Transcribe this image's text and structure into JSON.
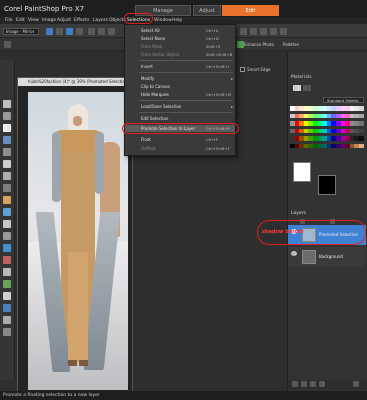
{
  "app": {
    "title": "Corel PaintShop Pro X7",
    "workspace_tabs": [
      "Manage",
      "Adjust",
      "Edit"
    ],
    "active_workspace": "Edit"
  },
  "menubar": {
    "items": [
      "File",
      "Edit",
      "View",
      "Image",
      "Adjust",
      "Effects",
      "Layers",
      "Objects",
      "Selections",
      "Window",
      "Help"
    ],
    "open_menu": "Selections"
  },
  "toolbar": {
    "preset": "Image - Mirror",
    "enhance_photo": "Enhance Photo",
    "palettes": "Palettes",
    "smart_edge": "Smart Edge"
  },
  "document": {
    "title": "hijab%20fashion (4)* @ 39% (Promoted Selection)"
  },
  "selections_menu": {
    "items": [
      {
        "label": "Select All",
        "shortcut": "Ctrl+A",
        "disabled": false
      },
      {
        "label": "Select None",
        "shortcut": "Ctrl+D",
        "disabled": false
      },
      {
        "label": "From Mask",
        "shortcut": "Shift+S",
        "disabled": true
      },
      {
        "label": "From Vector Object",
        "shortcut": "Shift+Shift+B",
        "disabled": true
      },
      {
        "label": "Invert",
        "shortcut": "Ctrl+Shift+I",
        "disabled": false
      },
      {
        "label": "Modify",
        "shortcut": "",
        "disabled": false,
        "submenu": true
      },
      {
        "label": "Clip to Canvas",
        "shortcut": "",
        "disabled": false
      },
      {
        "label": "Hide Marquee",
        "shortcut": "Ctrl+Shift+M",
        "disabled": false
      },
      {
        "label": "Load/Save Selection",
        "shortcut": "",
        "disabled": false,
        "submenu": true
      },
      {
        "label": "Edit Selection",
        "shortcut": "",
        "disabled": false
      },
      {
        "label": "Promote Selection to Layer",
        "shortcut": "Ctrl+Shift+P",
        "disabled": false,
        "highlighted": true
      },
      {
        "label": "Float",
        "shortcut": "Ctrl+F",
        "disabled": false
      },
      {
        "label": "Defloat",
        "shortcut": "Ctrl+Shift+F",
        "disabled": true
      }
    ]
  },
  "materials": {
    "title": "Materials",
    "swatch_set": "Standard Palette",
    "palette_colors": [
      "#ffffff",
      "#ffcccc",
      "#ffe6cc",
      "#ffffcc",
      "#e6ffcc",
      "#ccffcc",
      "#ccffe6",
      "#ccffff",
      "#cce6ff",
      "#ccccff",
      "#e6ccff",
      "#ffccff",
      "#ffcce6",
      "#f2f2f2",
      "#e6e6e6",
      "#d9d9d9",
      "#cccccc",
      "#ff6666",
      "#ffb366",
      "#ffff66",
      "#b3ff66",
      "#66ff66",
      "#66ffb3",
      "#66ffff",
      "#66b3ff",
      "#6666ff",
      "#b366ff",
      "#ff66ff",
      "#ff66b3",
      "#bfbfbf",
      "#b3b3b3",
      "#a6a6a6",
      "#999999",
      "#ff0000",
      "#ff8000",
      "#ffff00",
      "#80ff00",
      "#00ff00",
      "#00ff80",
      "#00ffff",
      "#0080ff",
      "#0000ff",
      "#8000ff",
      "#ff00ff",
      "#ff0080",
      "#8c8c8c",
      "#808080",
      "#737373",
      "#666666",
      "#cc0000",
      "#cc6600",
      "#cccc00",
      "#66cc00",
      "#00cc00",
      "#00cc66",
      "#00cccc",
      "#0066cc",
      "#0000cc",
      "#6600cc",
      "#cc00cc",
      "#cc0066",
      "#595959",
      "#4d4d4d",
      "#404040",
      "#333333",
      "#990000",
      "#994d00",
      "#999900",
      "#4d9900",
      "#009900",
      "#00994d",
      "#009999",
      "#004d99",
      "#000099",
      "#4d0099",
      "#990099",
      "#99004d",
      "#262626",
      "#1a1a1a",
      "#0d0d0d",
      "#000000",
      "#660000",
      "#663300",
      "#666600",
      "#336600",
      "#006600",
      "#006633",
      "#006666",
      "#003366",
      "#000066",
      "#330066",
      "#660066",
      "#660033",
      "#8b5a2b",
      "#c08850",
      "#e0b080"
    ]
  },
  "layers": {
    "title": "Layers",
    "rows": [
      {
        "name": "Promoted Selection",
        "selected": true
      },
      {
        "name": "Background",
        "selected": false
      }
    ],
    "annotation": "shadow border"
  },
  "status": {
    "text": "Promote a floating selection to a new layer"
  },
  "colors": {
    "accent": "#e9722d",
    "annotation": "#e02020"
  }
}
